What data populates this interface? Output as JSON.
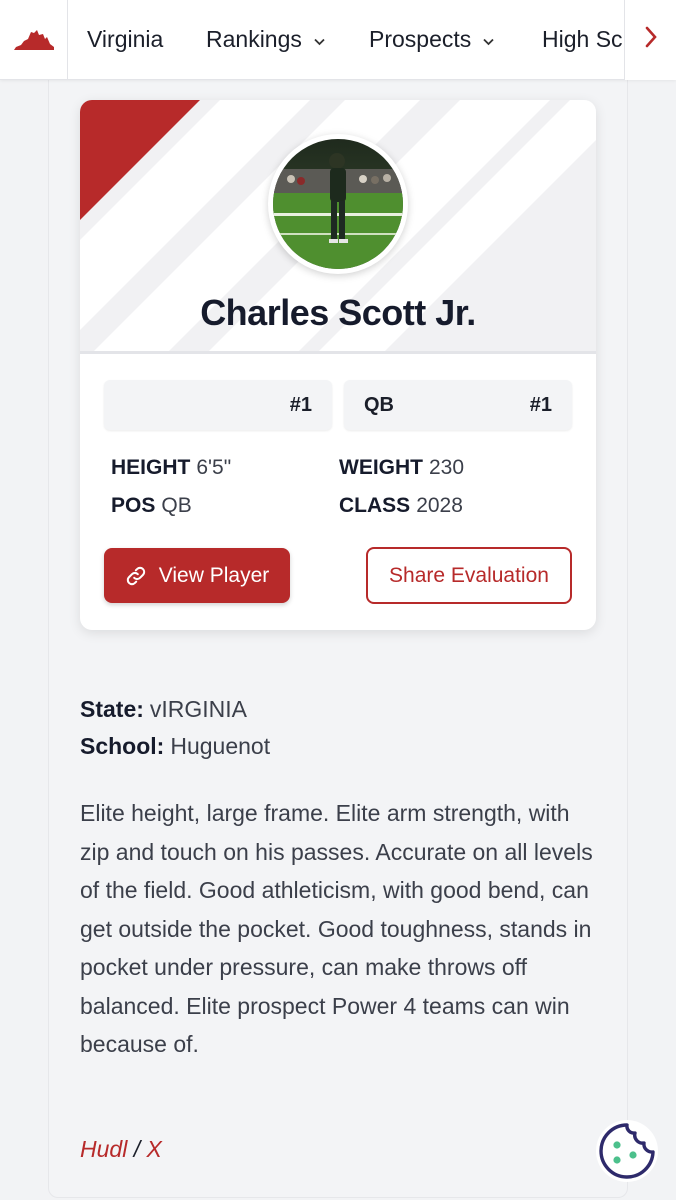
{
  "nav": {
    "items": [
      {
        "label": "Virginia",
        "has_dropdown": false
      },
      {
        "label": "Rankings",
        "has_dropdown": true
      },
      {
        "label": "Prospects",
        "has_dropdown": true
      },
      {
        "label": "High Sc",
        "has_dropdown": false
      }
    ],
    "dropdown_icon": "chevron-down-icon",
    "next_icon": "chevron-right-icon"
  },
  "player": {
    "name": "Charles Scott Jr.",
    "rank_overall_label": "",
    "rank_overall": "#1",
    "rank_position_label": "QB",
    "rank_position": "#1",
    "stats": {
      "height_label": "HEIGHT",
      "height": "6'5\"",
      "weight_label": "WEIGHT",
      "weight": "230",
      "pos_label": "POS",
      "pos": "QB",
      "class_label": "CLASS",
      "class": "2028"
    },
    "view_button": "View Player",
    "share_button": "Share Evaluation"
  },
  "details": {
    "state_label": "State:",
    "state": "vIRGINIA",
    "school_label": "School:",
    "school": "Huguenot"
  },
  "evaluation": "Elite height, large frame. Elite arm strength, with zip and touch on his passes. Accurate on all levels of the field. Good athleticism, with good bend, can get outside the pocket. Good toughness, stands in pocket under pressure, can make throws off balanced. Elite prospect Power 4 teams can win because of.",
  "links": {
    "hudl": "Hudl",
    "separator": "/",
    "x": "X"
  },
  "colors": {
    "accent": "#b72a2a",
    "text_dark": "#161b2c",
    "text_body": "#3b3f4a",
    "page_bg": "#f2f3f5"
  },
  "icons": {
    "brand": "virginia-state-icon",
    "link": "link-icon",
    "cookie": "cookie-icon"
  }
}
